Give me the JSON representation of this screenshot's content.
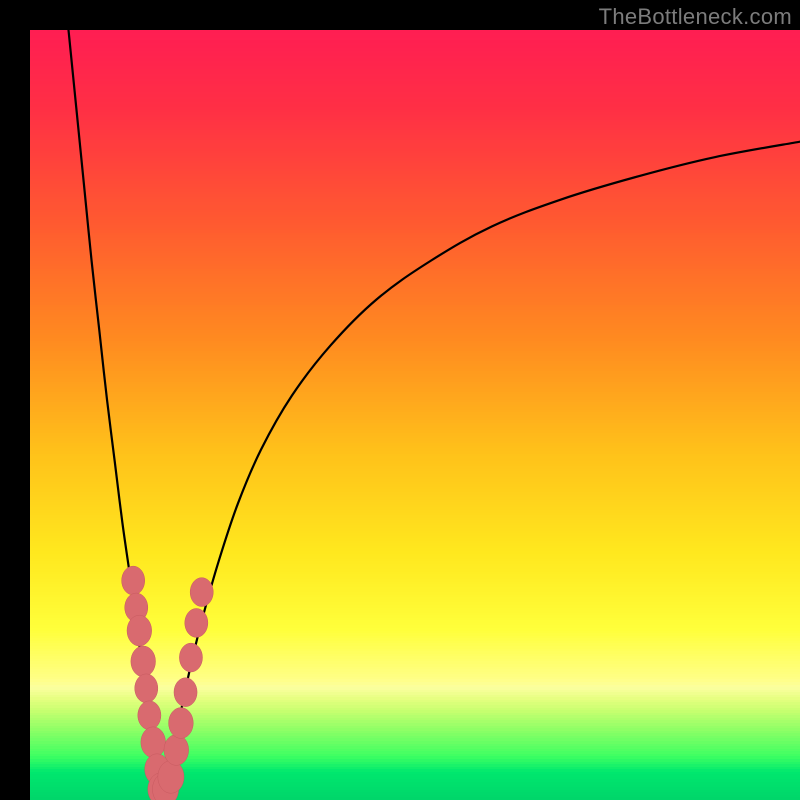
{
  "watermark": {
    "text": "TheBottleneck.com"
  },
  "colors": {
    "frame": "#000000",
    "curve": "#000000",
    "marker_fill": "#d96a6f",
    "marker_stroke": "#c85a60",
    "gradient_stops": [
      {
        "pos": 0.0,
        "color": "#ff1e52"
      },
      {
        "pos": 0.1,
        "color": "#ff2f45"
      },
      {
        "pos": 0.25,
        "color": "#ff5a30"
      },
      {
        "pos": 0.4,
        "color": "#ff8a20"
      },
      {
        "pos": 0.55,
        "color": "#ffc21a"
      },
      {
        "pos": 0.68,
        "color": "#ffe81e"
      },
      {
        "pos": 0.78,
        "color": "#ffff3b"
      },
      {
        "pos": 0.845,
        "color": "#ffff88"
      },
      {
        "pos": 0.855,
        "color": "#fbffa0"
      },
      {
        "pos": 0.87,
        "color": "#e6ff80"
      },
      {
        "pos": 0.885,
        "color": "#c8ff70"
      },
      {
        "pos": 0.91,
        "color": "#8eff66"
      },
      {
        "pos": 0.945,
        "color": "#3dff62"
      },
      {
        "pos": 0.965,
        "color": "#00e86e"
      },
      {
        "pos": 1.0,
        "color": "#00d66a"
      }
    ]
  },
  "chart_data": {
    "type": "line",
    "title": "",
    "xlabel": "",
    "ylabel": "",
    "xlim": [
      0,
      100
    ],
    "ylim": [
      0,
      100
    ],
    "notch_x": 17,
    "series": [
      {
        "name": "left-branch",
        "x": [
          5.0,
          6.0,
          7.0,
          8.0,
          9.0,
          10.0,
          11.0,
          12.0,
          13.0,
          13.8,
          14.5,
          15.2,
          15.8,
          16.3,
          16.7,
          17.0
        ],
        "y": [
          100,
          90,
          80,
          70,
          61,
          52,
          44,
          36,
          29,
          23,
          18,
          13,
          9,
          5.5,
          2.5,
          0.5
        ]
      },
      {
        "name": "right-branch",
        "x": [
          17.0,
          17.8,
          18.7,
          19.7,
          21.0,
          22.5,
          24.5,
          27.0,
          30.0,
          34.0,
          39.0,
          45.0,
          52.0,
          60.0,
          69.0,
          79.0,
          89.0,
          100.0
        ],
        "y": [
          0.5,
          3.0,
          7.0,
          12.0,
          18.0,
          24.0,
          31.0,
          38.5,
          45.5,
          52.5,
          59.0,
          65.0,
          70.0,
          74.5,
          78.0,
          81.0,
          83.5,
          85.5
        ]
      }
    ],
    "markers": [
      {
        "x": 13.4,
        "y": 28.5,
        "r": 1.5
      },
      {
        "x": 13.8,
        "y": 25.0,
        "r": 1.5
      },
      {
        "x": 14.2,
        "y": 22.0,
        "r": 1.6
      },
      {
        "x": 14.7,
        "y": 18.0,
        "r": 1.6
      },
      {
        "x": 15.1,
        "y": 14.5,
        "r": 1.5
      },
      {
        "x": 15.5,
        "y": 11.0,
        "r": 1.5
      },
      {
        "x": 16.0,
        "y": 7.5,
        "r": 1.6
      },
      {
        "x": 16.5,
        "y": 4.0,
        "r": 1.6
      },
      {
        "x": 17.0,
        "y": 1.4,
        "r": 1.7
      },
      {
        "x": 17.6,
        "y": 1.4,
        "r": 1.7
      },
      {
        "x": 18.3,
        "y": 3.0,
        "r": 1.7
      },
      {
        "x": 19.0,
        "y": 6.5,
        "r": 1.6
      },
      {
        "x": 19.6,
        "y": 10.0,
        "r": 1.6
      },
      {
        "x": 20.2,
        "y": 14.0,
        "r": 1.5
      },
      {
        "x": 20.9,
        "y": 18.5,
        "r": 1.5
      },
      {
        "x": 21.6,
        "y": 23.0,
        "r": 1.5
      },
      {
        "x": 22.3,
        "y": 27.0,
        "r": 1.5
      }
    ]
  }
}
